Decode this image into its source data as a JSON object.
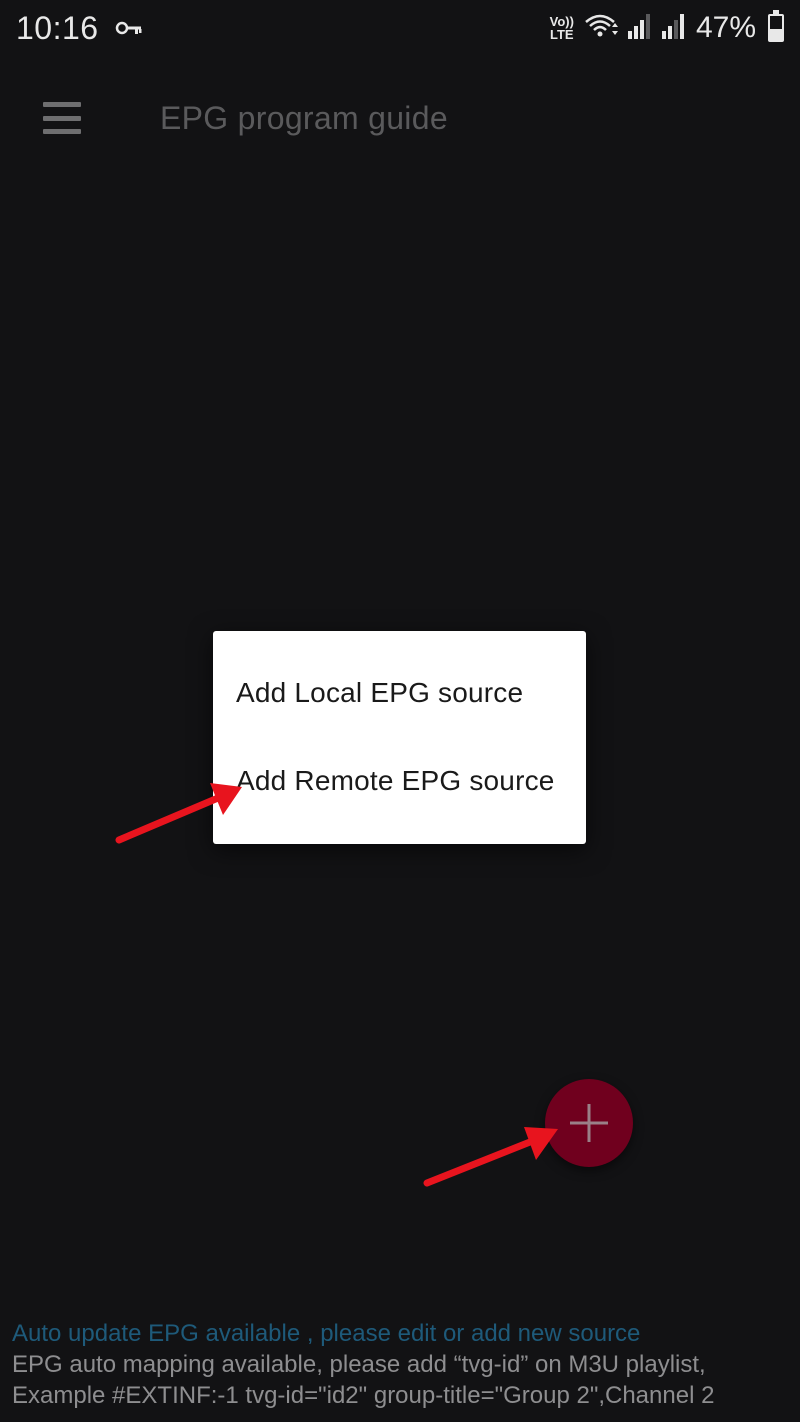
{
  "status_bar": {
    "time": "10:16",
    "key_icon": "key-icon",
    "volte_top": "Vo))",
    "volte_bottom": "LTE",
    "battery_percent": "47%",
    "battery_level": 0.47
  },
  "app_bar": {
    "menu_icon": "hamburger-menu-icon",
    "title": "EPG program guide"
  },
  "popup_menu": {
    "items": [
      {
        "label": "Add Local EPG source"
      },
      {
        "label": "Add Remote EPG source"
      }
    ]
  },
  "fab": {
    "icon": "plus-icon",
    "color": "#70001e"
  },
  "footer": {
    "notice": "Auto update EPG available , please edit or add new source",
    "line1": "EPG auto mapping available, please add “tvg-id” on M3U playlist,",
    "line2": "Example #EXTINF:-1 tvg-id=\"id2\" group-title=\"Group 2\",Channel 2"
  },
  "colors": {
    "background": "#121214",
    "annotation_arrow": "#e8141e",
    "notice_text": "#1e5a7a"
  }
}
